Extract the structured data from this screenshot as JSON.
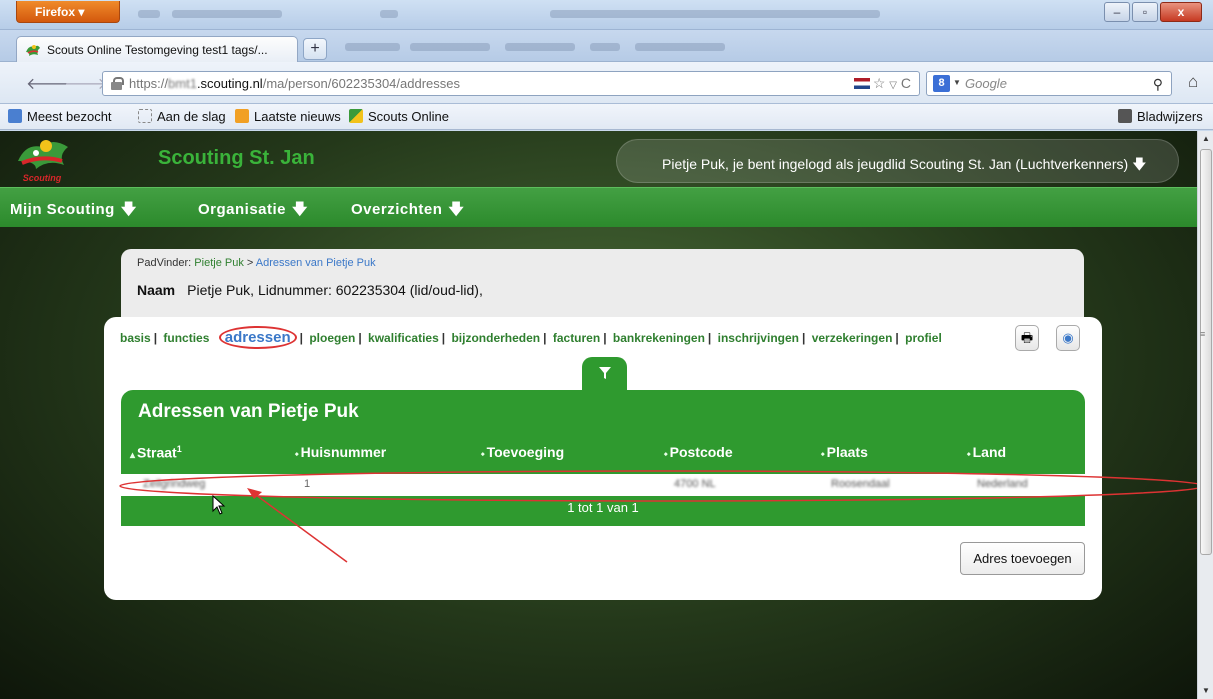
{
  "browser": {
    "menu_label": "Firefox ▾",
    "tab_title": "Scouts Online Testomgeving test1 tags/...",
    "new_tab": "+",
    "url_prefix": "https://",
    "url_host_blurred": "bmt1",
    "url_host": ".scouting.nl",
    "url_path": "/ma/person/602235304/addresses",
    "search_placeholder": "Google",
    "search_engine_letter": "8",
    "window_controls": [
      "–",
      "▫",
      "x"
    ]
  },
  "bookmarks": {
    "items": [
      "Meest bezocht",
      "Aan de slag",
      "Laatste nieuws",
      "Scouts Online"
    ],
    "right": "Bladwijzers"
  },
  "site": {
    "logo_text": "Scouting",
    "group_name": "Scouting St. Jan",
    "user_text": "Pietje Puk, je bent ingelogd als jeugdlid Scouting St. Jan (Luchtverkenners)",
    "menu": [
      "Mijn Scouting",
      "Organisatie",
      "Overzichten"
    ]
  },
  "person": {
    "breadcrumb_root": "PadVinder:",
    "breadcrumb_person": "Pietje Puk",
    "breadcrumb_sep": ">",
    "breadcrumb_current": "Adressen van Pietje Puk",
    "naam_label": "Naam",
    "naam_value": "Pietje Puk, Lidnummer: 602235304 (lid/oud-lid),"
  },
  "tabs": {
    "items": [
      "basis",
      "functies",
      "adressen",
      "ploegen",
      "kwalificaties",
      "bijzonderheden",
      "facturen",
      "bankrekeningen",
      "inschrijvingen",
      "verzekeringen",
      "profiel"
    ],
    "active": "adressen"
  },
  "table": {
    "title": "Adressen van Pietje Puk",
    "columns": [
      "Straat",
      "Huisnummer",
      "Toevoeging",
      "Postcode",
      "Plaats",
      "Land"
    ],
    "straat_sup": "1",
    "row": {
      "straat": "Zeilgrindweg",
      "huisnummer": "1",
      "toevoeging": "",
      "postcode": "4700 NL",
      "plaats": "Roosendaal",
      "land": "Nederland"
    },
    "pager": "1 tot 1 van 1"
  },
  "actions": {
    "add_address": "Adres toevoegen"
  },
  "colors": {
    "green": "#2f9a2f",
    "link_blue": "#3b78c8",
    "annotation_red": "#d33"
  }
}
